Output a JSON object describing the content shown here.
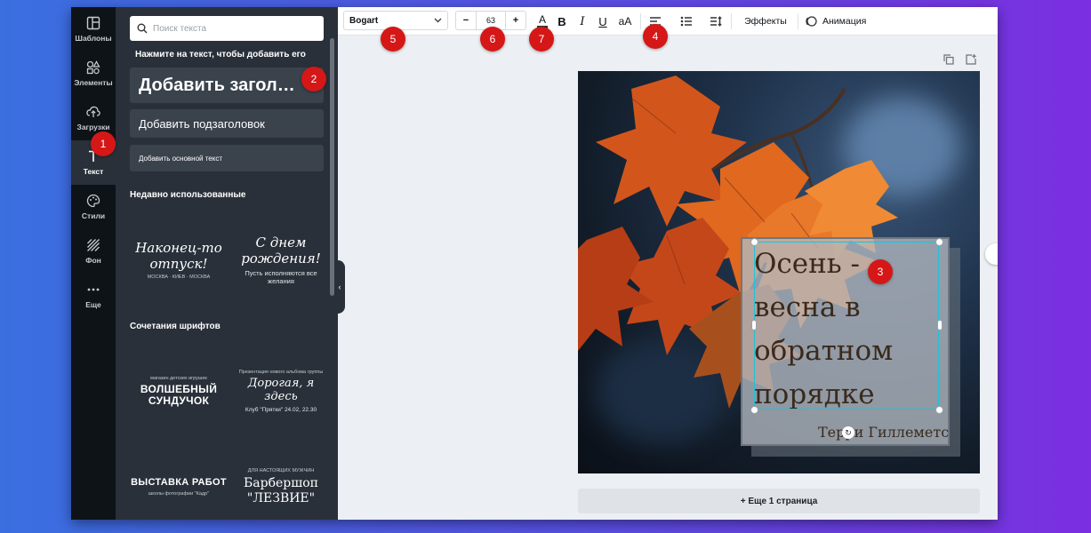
{
  "rail": {
    "items": [
      {
        "label": "Шаблоны",
        "icon": "templates-icon"
      },
      {
        "label": "Элементы",
        "icon": "elements-icon"
      },
      {
        "label": "Загрузки",
        "icon": "upload-icon"
      },
      {
        "label": "Текст",
        "icon": "text-icon",
        "active": true
      },
      {
        "label": "Стили",
        "icon": "palette-icon"
      },
      {
        "label": "Фон",
        "icon": "background-icon"
      },
      {
        "label": "Еще",
        "icon": "more-icon"
      }
    ]
  },
  "panel": {
    "search_placeholder": "Поиск текста",
    "hint": "Нажмите на текст, чтобы добавить его",
    "add_heading": "Добавить загол…",
    "add_subheading": "Добавить подзаголовок",
    "add_body": "Добавить основной текст",
    "recent_title": "Недавно использованные",
    "recent": [
      {
        "main": "Наконец-то отпуск!",
        "sub": "МОСКВА · КИЕВ · МОСКВА"
      },
      {
        "main": "С днем рождения!",
        "sub": "Пусть исполняются все желания"
      }
    ],
    "combos_title": "Сочетания шрифтов",
    "combos": [
      {
        "top": "магазин детских игрушек",
        "main": "ВОЛШЕБНЫЙ СУНДУЧОК"
      },
      {
        "top": "Презентация нового альбома группы",
        "main": "Дорогая, я здесь",
        "sub": "Клуб \"Прятки\" 24.02, 22.30"
      },
      {
        "main": "ВЫСТАВКА РАБОТ",
        "sub": "школы фотографии \"Кадр\""
      },
      {
        "top": "ДЛЯ НАСТОЯЩИХ МУЖЧИН",
        "main": "Барбершоп \"ЛЕЗВИЕ\""
      }
    ]
  },
  "toolbar": {
    "font": "Bogart",
    "font_size": "63",
    "minus": "−",
    "plus": "+",
    "color_label": "A",
    "bold_label": "B",
    "italic_label": "I",
    "underline_label": "U",
    "case_label": "aA",
    "effects": "Эффекты",
    "animation": "Анимация"
  },
  "canvas": {
    "quote": "Осень - весна в обратном порядке",
    "author": "Терри Гиллеметс",
    "more_pages": "+ Еще 1 страница"
  },
  "badges": [
    "1",
    "2",
    "3",
    "4",
    "5",
    "6",
    "7"
  ],
  "colors": {
    "rail_bg": "#0e1318",
    "panel_bg": "#293039",
    "selection": "#24c0d8",
    "badge": "#d51717"
  }
}
